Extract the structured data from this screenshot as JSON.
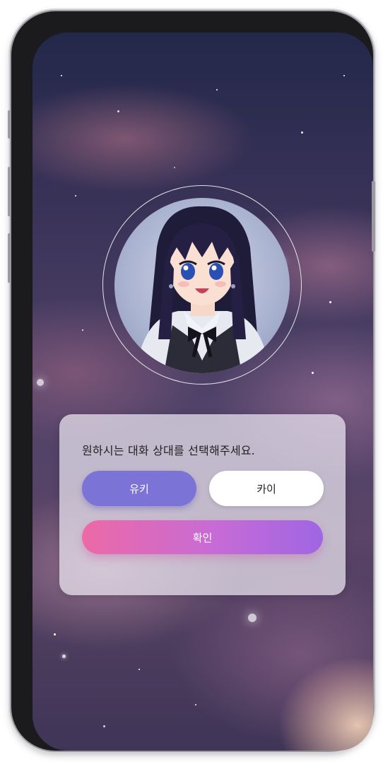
{
  "selection": {
    "prompt": "원하시는 대화 상대를 선택해주세요.",
    "options": [
      {
        "label": "유키",
        "selected": true
      },
      {
        "label": "카이",
        "selected": false
      }
    ],
    "confirm_label": "확인"
  },
  "colors": {
    "selected_option": "#7b74d6",
    "unselected_option": "#ffffff",
    "confirm_gradient_start": "#ec6aa6",
    "confirm_gradient_end": "#9f66e3"
  },
  "icons": {
    "avatar": "anime-girl-avatar"
  }
}
